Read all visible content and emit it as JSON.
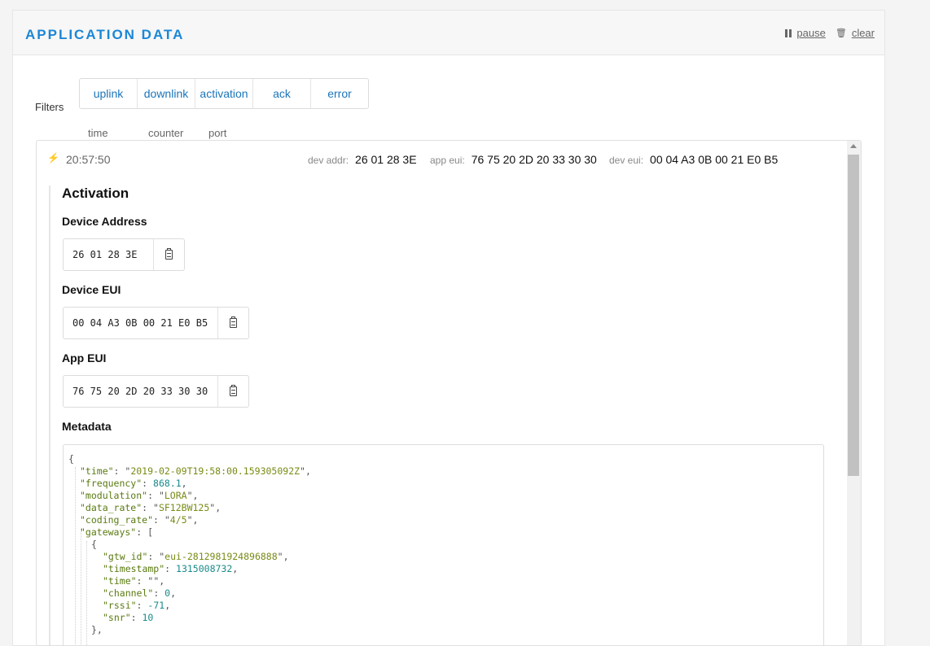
{
  "header": {
    "title": "APPLICATION DATA",
    "pause_label": "pause",
    "clear_label": "clear"
  },
  "filters": {
    "label": "Filters",
    "items": [
      "uplink",
      "downlink",
      "activation",
      "ack",
      "error"
    ]
  },
  "columns": [
    "time",
    "counter",
    "port"
  ],
  "event": {
    "icon": "bolt-icon",
    "time": "20:57:50",
    "dev_addr_label": "dev addr:",
    "dev_addr": "26 01 28 3E",
    "app_eui_label": "app eui:",
    "app_eui": "76 75 20 2D 20 33 30 30",
    "dev_eui_label": "dev eui:",
    "dev_eui": "00 04 A3 0B 00 21 E0 B5"
  },
  "activation": {
    "title": "Activation",
    "device_address_label": "Device Address",
    "device_address": "26 01 28 3E",
    "device_eui_label": "Device EUI",
    "device_eui": "00 04 A3 0B 00 21 E0 B5",
    "app_eui_label": "App EUI",
    "app_eui": "76 75 20 2D 20 33 30 30",
    "metadata_label": "Metadata"
  },
  "metadata": {
    "open": "{",
    "time": "2019-02-09T19:58:00.159305092Z",
    "frequency": "868.1",
    "modulation": "LORA",
    "data_rate": "SF12BW125",
    "coding_rate": "4/5",
    "gateways_open": "[",
    "gw_open": "{",
    "gtw_id": "eui-2812981924896888",
    "timestamp": "1315008732",
    "gw_time": "",
    "channel": "0",
    "rssi": "-71",
    "snr": "10",
    "gw_close": "},"
  }
}
